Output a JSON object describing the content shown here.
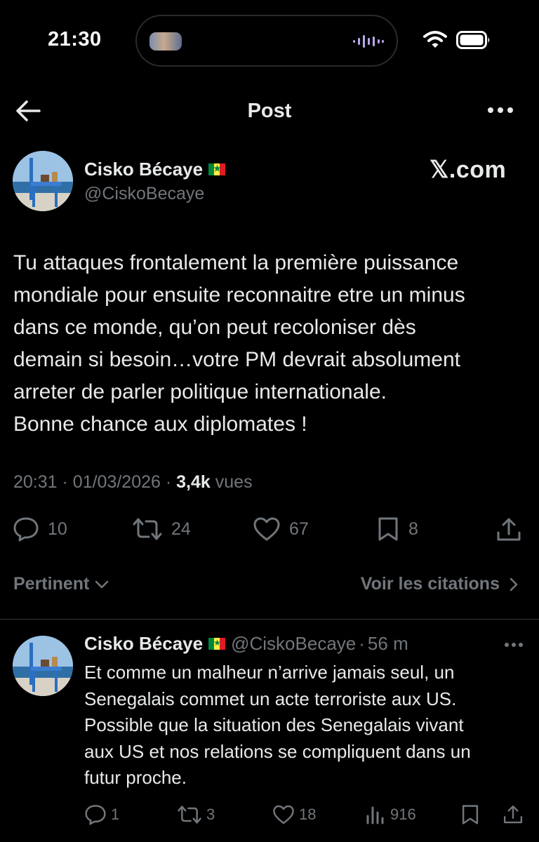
{
  "status_bar": {
    "time": "21:30"
  },
  "nav": {
    "title": "Post"
  },
  "post": {
    "author_name": "Cisko Bécaye",
    "handle": "@CiskoBecaye",
    "brand": "𝕏.com",
    "text": "Tu attaques frontalement la première puissance\nmondiale pour ensuite reconnaitre etre un minus\ndans ce monde, qu’on peut recoloniser dès\ndemain si besoin…votre PM devrait absolument\narreter de parler politique internationale.\nBonne chance aux diplomates !",
    "time": "20:31",
    "date": "01/03/2026",
    "views": "3,4k",
    "views_label": "vues",
    "sep": "·",
    "replies": "10",
    "reposts": "24",
    "likes": "67",
    "bookmarks": "8"
  },
  "sort": {
    "label": "Pertinent",
    "quotes_label": "Voir les citations"
  },
  "reply": {
    "author_name": "Cisko Bécaye",
    "handle": "@CiskoBecaye",
    "age": "56 m",
    "sep": "·",
    "text": "Et comme un malheur n’arrive jamais seul, un\nSenegalais commet un acte terroriste aux US.\nPossible que la situation des Senegalais vivant\naux US et nos relations se compliquent dans un\nfutur proche.",
    "replies": "1",
    "reposts": "3",
    "likes": "18",
    "views": "916"
  },
  "icons": {
    "back": "arrow-left-icon",
    "more": "more-horizontal-icon",
    "reply": "speech-bubble-icon",
    "repost": "repost-icon",
    "like": "heart-icon",
    "bookmark": "bookmark-icon",
    "share": "share-icon",
    "views": "bar-chart-icon",
    "flag": "senegal-flag-icon"
  },
  "colors": {
    "background": "#000000",
    "text": "#e7e9ea",
    "secondary": "#71767b",
    "divider": "#2f3336"
  }
}
